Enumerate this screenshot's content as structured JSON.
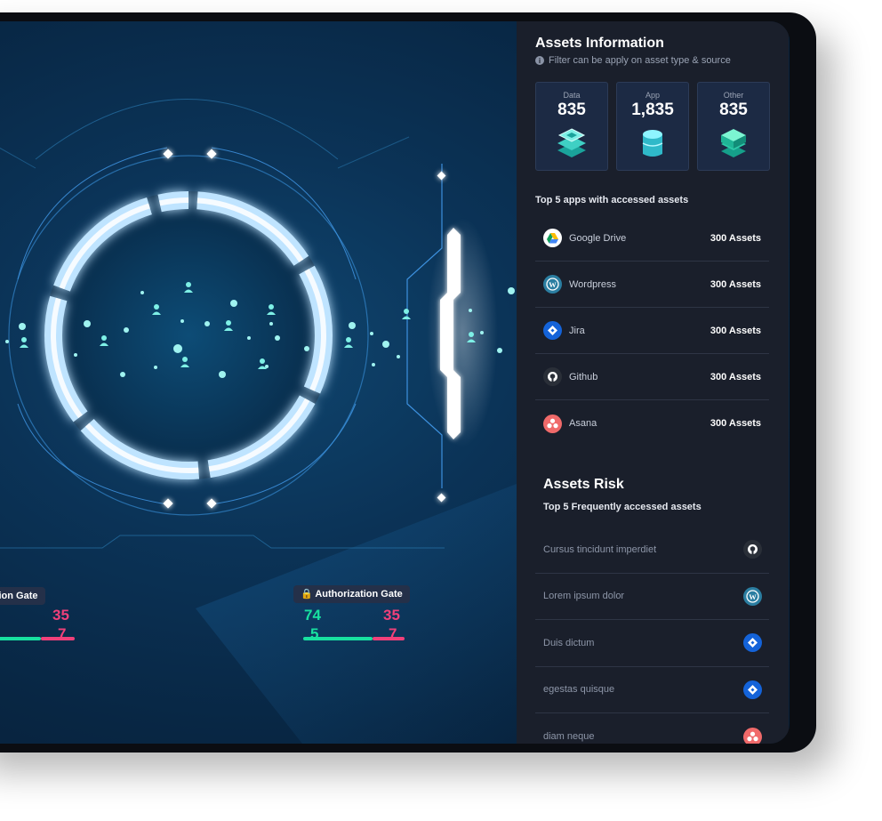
{
  "gates": {
    "authentication": {
      "label": "Authentication Gate",
      "value_top": "35",
      "value_bottom": "7"
    },
    "authorization": {
      "label": "Authorization Gate",
      "value_green_top": "74",
      "value_pink_top": "35",
      "value_green_bottom": "5",
      "value_pink_bottom": "7"
    }
  },
  "panel": {
    "title": "Assets Information",
    "subtitle": "Filter can be apply on asset type & source",
    "cards": [
      {
        "label": "Data",
        "value": "835",
        "icon": "layered-chip-icon"
      },
      {
        "label": "App",
        "value": "1,835",
        "icon": "cylinder-stack-icon"
      },
      {
        "label": "Other",
        "value": "835",
        "icon": "cube-stack-icon"
      }
    ],
    "apps_heading": "Top 5 apps with accessed assets",
    "apps": [
      {
        "name": "Google Drive",
        "count": "300 Assets",
        "icon": "google-drive-icon"
      },
      {
        "name": "Wordpress",
        "count": "300 Assets",
        "icon": "wordpress-icon"
      },
      {
        "name": "Jira",
        "count": "300 Assets",
        "icon": "jira-icon"
      },
      {
        "name": "Github",
        "count": "300 Assets",
        "icon": "github-icon"
      },
      {
        "name": "Asana",
        "count": "300 Assets",
        "icon": "asana-icon"
      }
    ],
    "risk_title": "Assets Risk",
    "risk_heading": "Top 5 Frequently accessed assets",
    "risk_items": [
      {
        "name": "Cursus tincidunt imperdiet",
        "icon": "github-icon"
      },
      {
        "name": "Lorem ipsum dolor",
        "icon": "wordpress-icon"
      },
      {
        "name": "Duis dictum",
        "icon": "jira-icon"
      },
      {
        "name": "egestas quisque",
        "icon": "jira-icon"
      },
      {
        "name": "diam neque",
        "icon": "asana-icon"
      }
    ]
  },
  "colors": {
    "accent_green": "#18e0a0",
    "accent_pink": "#f0407a",
    "panel_bg": "#1a1f2b",
    "glow": "#4aa8ff"
  }
}
